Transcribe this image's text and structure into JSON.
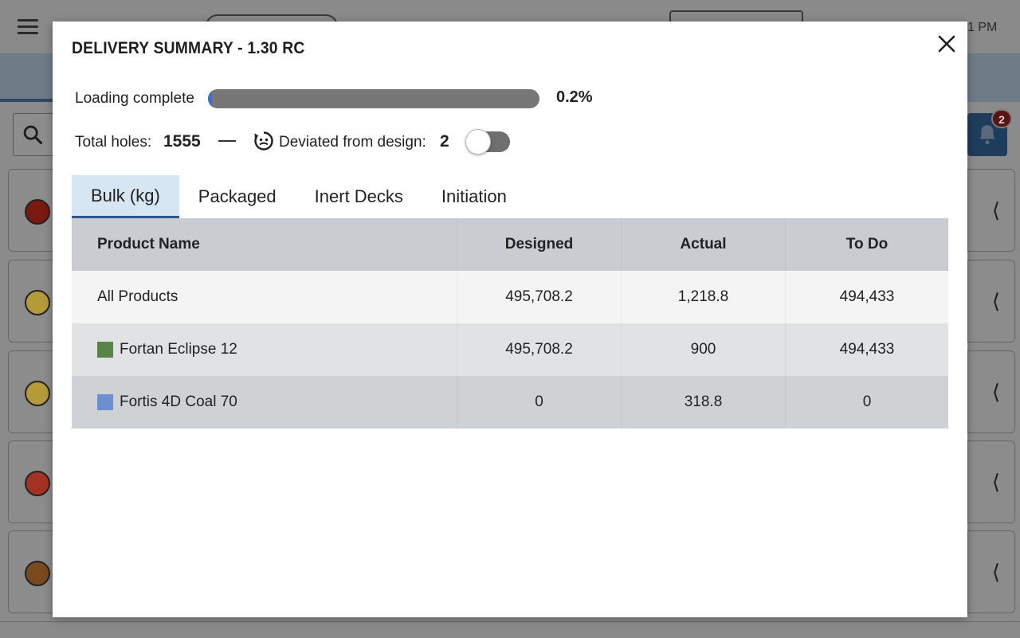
{
  "background": {
    "time": "1 PM",
    "notification_count": "2",
    "row_icon_colors": [
      "#7a1a0e",
      "#b59a3a",
      "#b59a3a",
      "#a43222",
      "#7a4a1e"
    ]
  },
  "modal": {
    "title": "DELIVERY SUMMARY - 1.30 RC",
    "progress": {
      "label": "Loading complete",
      "percent_text": "0.2%",
      "fraction": 0.002
    },
    "stats": {
      "total_holes_label": "Total holes:",
      "total_holes_value": "1555",
      "deviated_label": "Deviated from design:",
      "deviated_value": "2",
      "toggle_on": false
    },
    "tabs": [
      {
        "label": "Bulk (kg)",
        "active": true
      },
      {
        "label": "Packaged",
        "active": false
      },
      {
        "label": "Inert Decks",
        "active": false
      },
      {
        "label": "Initiation",
        "active": false
      }
    ],
    "table": {
      "headers": {
        "name": "Product Name",
        "designed": "Designed",
        "actual": "Actual",
        "todo": "To Do"
      },
      "rows": [
        {
          "name": "All Products",
          "designed": "495,708.2",
          "actual": "1,218.8",
          "todo": "494,433"
        },
        {
          "name": "Fortan Eclipse 12",
          "swatch": "#56844a",
          "designed": "495,708.2",
          "actual": "900",
          "todo": "494,433"
        },
        {
          "name": "Fortis 4D Coal 70",
          "swatch": "#6d8fcf",
          "designed": "0",
          "actual": "318.8",
          "todo": "0"
        }
      ]
    }
  },
  "colors": {
    "active_tab_bg": "#d6e6f3",
    "active_tab_underline": "#2c5a8c",
    "progress_track": "#777777",
    "progress_fill": "#3b6fd0"
  }
}
